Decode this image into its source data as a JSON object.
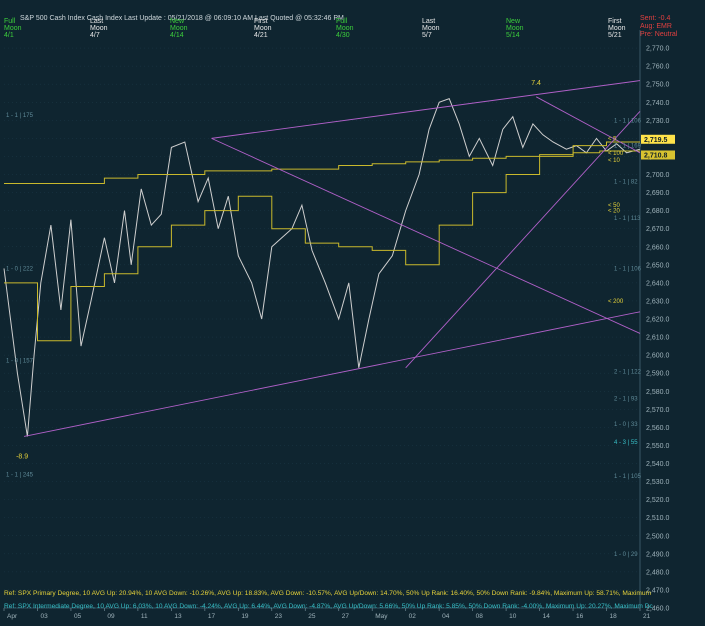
{
  "header": {
    "title": "S&P 500 Cash Index  Cash Index  Last Update : 05/21/2018 @ 06:09:10 AM  Last Quoted @ 05:32:46 PM",
    "moons": [
      {
        "line1": "Full",
        "line2": "Moon",
        "line3": "4/1",
        "color": "#3ccf3c"
      },
      {
        "line1": "Last",
        "line2": "Moon",
        "line3": "4/7",
        "color": "#e8e8e8"
      },
      {
        "line1": "New",
        "line2": "Moon",
        "line3": "4/14",
        "color": "#3ccf3c"
      },
      {
        "line1": "First",
        "line2": "Moon",
        "line3": "4/21",
        "color": "#e8e8e8"
      },
      {
        "line1": "Full",
        "line2": "Moon",
        "line3": "4/30",
        "color": "#3ccf3c"
      },
      {
        "line1": "Last",
        "line2": "Moon",
        "line3": "5/7",
        "color": "#e8e8e8"
      },
      {
        "line1": "New",
        "line2": "Moon",
        "line3": "5/14",
        "color": "#3ccf3c"
      },
      {
        "line1": "First",
        "line2": "Moon",
        "line3": "5/21",
        "color": "#e8e8e8"
      }
    ],
    "status": {
      "l1": "Sent: -0.4",
      "l2": "Aug: EMR",
      "l3": "Pre: Neutral"
    }
  },
  "chart_data": {
    "type": "line",
    "ylim": [
      2460,
      2780
    ],
    "x_ticks": [
      "Apr",
      "03",
      "05",
      "09",
      "11",
      "13",
      "17",
      "19",
      "23",
      "25",
      "27",
      "May",
      "02",
      "04",
      "08",
      "10",
      "14",
      "16",
      "18",
      "21"
    ],
    "y_ticks": [
      2460,
      2470,
      2480,
      2490,
      2500,
      2510,
      2520,
      2530,
      2540,
      2550,
      2560,
      2570,
      2580,
      2590,
      2600,
      2610,
      2620,
      2630,
      2640,
      2650,
      2660,
      2670,
      2680,
      2690,
      2700,
      2710,
      2720,
      2730,
      2740,
      2750,
      2760,
      2770
    ],
    "price_labels": [
      {
        "text": "2,719.5",
        "value": 2719.5
      },
      {
        "text": "2,710.8",
        "value": 2710.8
      }
    ],
    "series": [
      {
        "name": "",
        "color": "#cfcfcf",
        "x": [
          0,
          0.4,
          0.7,
          0.9,
          1.1,
          1.4,
          1.7,
          2.0,
          2.3,
          2.6,
          3.0,
          3.3,
          3.6,
          3.8,
          4.1,
          4.4,
          4.7,
          5.0,
          5.4,
          5.8,
          6.1,
          6.4,
          6.7,
          7.0,
          7.4,
          7.7,
          8.0,
          8.3,
          8.6,
          8.9,
          9.2,
          9.6,
          10.0,
          10.3,
          10.6,
          10.9,
          11.2,
          11.6,
          12.0,
          12.4,
          12.7,
          13.0,
          13.3,
          13.6,
          13.9,
          14.2,
          14.6,
          14.9,
          15.2,
          15.5,
          15.8,
          16.1,
          16.4,
          16.8,
          17.1,
          17.4,
          17.7,
          18.0,
          18.3,
          18.6,
          19.0
        ],
        "values": [
          2648,
          2590,
          2555,
          2600,
          2640,
          2672,
          2625,
          2675,
          2605,
          2630,
          2665,
          2640,
          2680,
          2650,
          2692,
          2672,
          2678,
          2715,
          2718,
          2685,
          2698,
          2670,
          2688,
          2655,
          2640,
          2620,
          2660,
          2665,
          2670,
          2683,
          2658,
          2640,
          2620,
          2640,
          2593,
          2620,
          2645,
          2655,
          2680,
          2700,
          2725,
          2740,
          2742,
          2728,
          2710,
          2720,
          2705,
          2725,
          2732,
          2715,
          2728,
          2722,
          2718,
          2714,
          2716,
          2712,
          2720,
          2713,
          2717,
          2712,
          2714
        ]
      },
      {
        "name": "",
        "color": "#c9b92c",
        "x": [
          0,
          3,
          4,
          6,
          8,
          10,
          11,
          12,
          13,
          14,
          15,
          16,
          17,
          17.8,
          19
        ],
        "values": [
          2695,
          2698,
          2700,
          2702,
          2703,
          2705,
          2706,
          2707,
          2708,
          2709,
          2710,
          2711,
          2712,
          2713,
          2713
        ]
      },
      {
        "name": "",
        "color": "#c9b92c",
        "x": [
          0,
          1,
          2,
          3,
          4,
          5,
          6,
          7,
          8,
          9,
          10,
          11,
          12,
          13,
          14,
          15,
          16,
          17,
          18,
          19
        ],
        "values": [
          2640,
          2608,
          2638,
          2645,
          2660,
          2672,
          2680,
          2688,
          2670,
          2662,
          2660,
          2658,
          2650,
          2672,
          2690,
          2700,
          2710,
          2716,
          2718,
          2718
        ]
      }
    ],
    "trendlines": [
      {
        "color": "#b060c8",
        "x1": 6.2,
        "y1": 2720,
        "x2": 19,
        "y2": 2752
      },
      {
        "color": "#b060c8",
        "x1": 6.2,
        "y1": 2720,
        "x2": 19,
        "y2": 2612
      },
      {
        "color": "#b060c8",
        "x1": 0.6,
        "y1": 2555,
        "x2": 19,
        "y2": 2624
      },
      {
        "color": "#b060c8",
        "x1": 12.0,
        "y1": 2593,
        "x2": 19,
        "y2": 2735
      },
      {
        "color": "#b060c8",
        "x1": 15.9,
        "y1": 2743,
        "x2": 19,
        "y2": 2712
      }
    ]
  },
  "annotations": {
    "peak": "7.4",
    "trough": "-8.9",
    "gann_labels": [
      "1 - 1 | 175",
      "1 - 0 | 222",
      "1 - 0 | 157",
      "1 - 1 | 245",
      "1 - 1 | 106",
      "1 - 1 | 169",
      "1 - 1 | 82",
      "1 - 1 | 113",
      "1 - 1 | 106",
      "2 - 1 | 122",
      "2 - 1 | 93",
      "1 - 0 | 33",
      "4 - 3 | 55",
      "1 - 1 | 105",
      "1 - 0 | 29"
    ],
    "ma_labels": [
      "< 5",
      "< 100",
      "< 10",
      "< 50",
      "< 20",
      "< 200"
    ]
  },
  "footer": {
    "ref1": "Ref: SPX Primary Degree, 10 AVG Up: 20.94%, 10 AVG Down: -10.26%, AVG Up: 18.83%, AVG Down: -10.57%, AVG Up/Down: 14.70%, 50%  Up Rank: 16.40%, 50% Down Rank: -9.84%, Maximum Up: 58.71%, Maximum",
    "ref2": "Ref: SPX Intermediate Degree, 10 AVG Up: 6.03%, 10 AVG Down: -4.24%, AVG Up: 6.44%, AVG Down: -4.87%, AVG Up/Down: 5.66%, 50%  Up Rank: 5.85%, 50% Down Rank: -4.00%, Maximum Up: 20.27%, Maximum Dc"
  },
  "colors": {
    "bg": "#0f2530",
    "grid": "#1d3a48",
    "price": "#cfcfcf",
    "trend": "#b060c8",
    "ma": "#c9b92c",
    "label": "#5f8a98",
    "cyan": "#38c0c8",
    "yellow": "#e6d23a"
  }
}
